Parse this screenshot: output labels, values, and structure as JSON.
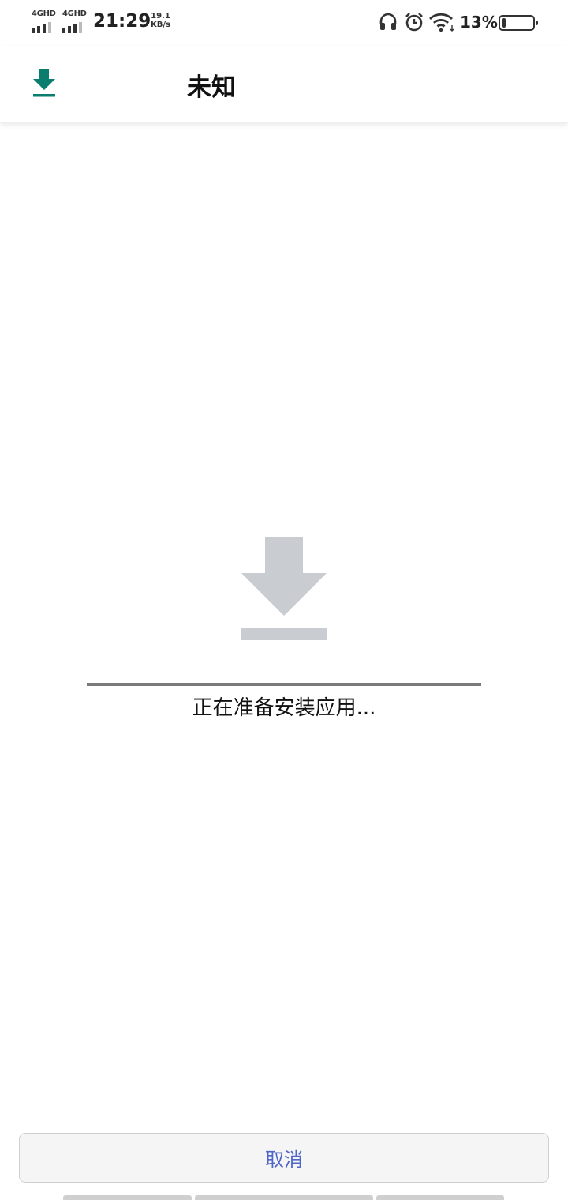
{
  "status_bar": {
    "sim1": "4GHD",
    "sim2": "4GHD",
    "time": "21:29",
    "speed_value": "19.1",
    "speed_unit": "KB/s",
    "battery_percent": "13%",
    "battery_level": 0.13,
    "icons": [
      "headphones-icon",
      "alarm-icon",
      "wifi-icon",
      "battery-icon"
    ]
  },
  "app_bar": {
    "icon": "download-icon",
    "title": "未知"
  },
  "main": {
    "icon": "download-icon",
    "progress": 1.0,
    "status_text": "正在准备安装应用..."
  },
  "actions": {
    "cancel_label": "取消"
  },
  "colors": {
    "accent": "#0b7d6e",
    "button_text": "#4f66c8",
    "icon_gray": "#c9cdd1"
  }
}
